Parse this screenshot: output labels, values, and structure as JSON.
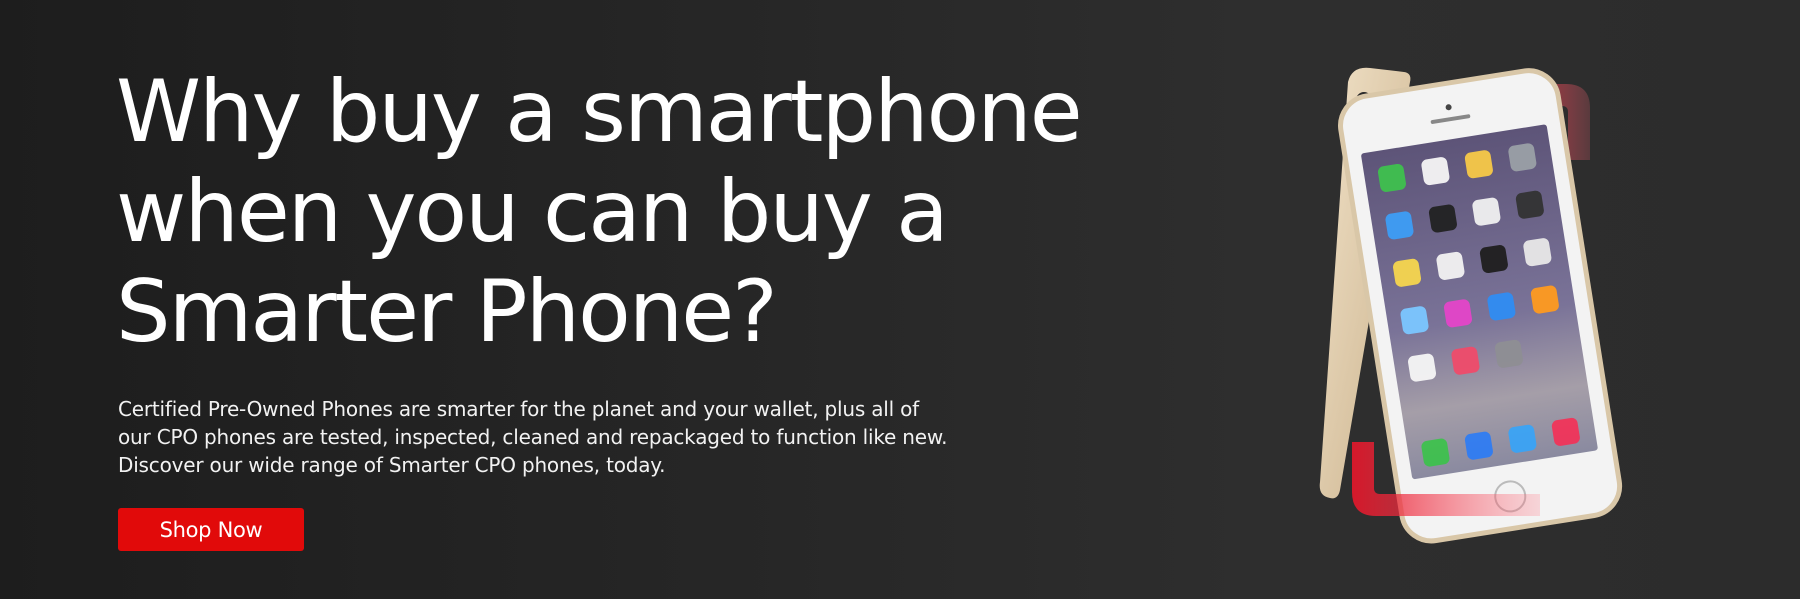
{
  "hero": {
    "headline_lines": [
      "Why buy a smartphone",
      "when you can buy a",
      "Smarter Phone?"
    ],
    "body_lines": [
      "Certified Pre-Owned Phones are smarter for the planet and your wallet, plus all of",
      "our CPO phones are tested, inspected, cleaned and repackaged to function like new.",
      "Discover our wide range of Smarter CPO phones, today."
    ],
    "cta_label": "Shop Now"
  },
  "colors": {
    "background": "#262626",
    "accent": "#e10a0a",
    "text": "#ffffff",
    "phone_body": "#e2cfb2"
  },
  "icons": {
    "product_image": "smartphone-image",
    "brand_mark": "bracket-logo-mark"
  }
}
